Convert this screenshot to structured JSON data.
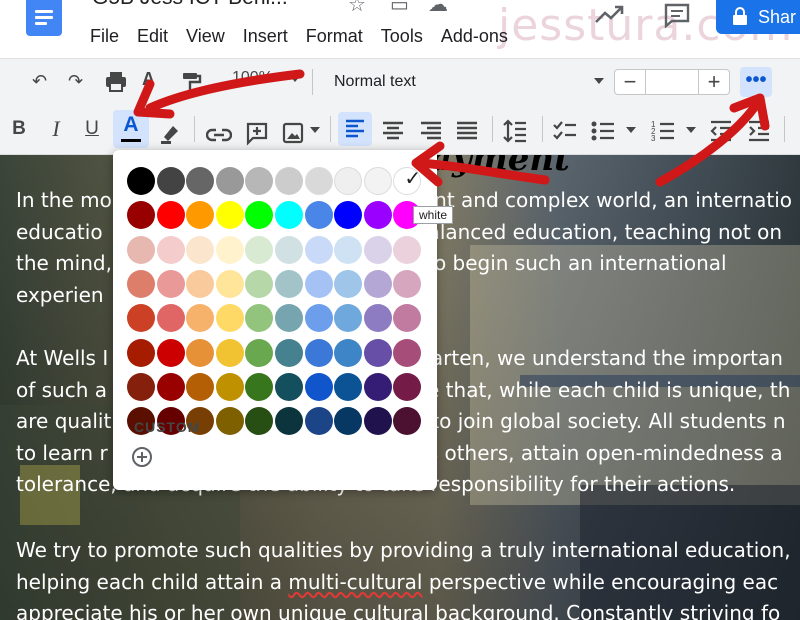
{
  "app": {
    "doc_title": "G5B Jess ICT Beni...",
    "watermark": "jesstura.com",
    "menu": [
      "File",
      "Edit",
      "View",
      "Insert",
      "Format",
      "Tools",
      "Add-ons"
    ],
    "share_label": "Shar"
  },
  "toolbar": {
    "zoom": "100%",
    "paragraph_style": "Normal text",
    "font_size_minus": "−",
    "font_size_plus": "+",
    "font_size_value": "",
    "more_label": "•••",
    "bold": "B",
    "italic": "I",
    "underline": "U",
    "text_color": "A"
  },
  "document": {
    "heading_fragment": "ayment",
    "paragraphs": [
      [
        "In the mo",
        "ent and complex world, an internatio",
        "educatio",
        "alanced education, teaching not on",
        "the mind,",
        "o begin such an international",
        "experien"
      ],
      []
    ],
    "p1": [
      {
        "a": "In the mo",
        "b": "ent and complex world, an internatio"
      },
      {
        "a": "educatio",
        "b": "alanced education, teaching not on"
      },
      {
        "a": "the mind,",
        "b": "o begin such an international"
      },
      {
        "a": "experien",
        "b": ""
      }
    ],
    "p2": [
      {
        "a": "At Wells I",
        "b": "garten, we understand the importan"
      },
      {
        "a": "of such a",
        "b": "e that, while each child is unique, th"
      },
      {
        "a": "are qualit",
        "b": "to join global society. All students n"
      },
      {
        "a": "to learn r",
        "b": "s others, attain open-mindedness a"
      },
      {
        "a": "tolerance, and acquire the ability to take responsibility for their actions.",
        "b": ""
      }
    ],
    "p3": [
      "We try to promote such qualities by providing a truly international education,",
      "helping each child attain a multi-cultural perspective while encouraging eac",
      "appreciate his or her own unique cultural background. Constantly striving fo"
    ],
    "p3_misspelled": "multi-cultural"
  },
  "palette": {
    "rows": [
      [
        "#000000",
        "#434343",
        "#666666",
        "#999999",
        "#b7b7b7",
        "#cccccc",
        "#d9d9d9",
        "#efefef",
        "#f3f3f3",
        "#ffffff"
      ],
      [
        "#980000",
        "#ff0000",
        "#ff9900",
        "#ffff00",
        "#00ff00",
        "#00ffff",
        "#4a86e8",
        "#0000ff",
        "#9900ff",
        "#ff00ff"
      ],
      [
        "#e6b8af",
        "#f4cccc",
        "#fce5cd",
        "#fff2cc",
        "#d9ead3",
        "#d0e0e3",
        "#c9daf8",
        "#cfe2f3",
        "#d9d2e9",
        "#ead1dc"
      ],
      [
        "#dd7e6b",
        "#ea9999",
        "#f9cb9c",
        "#ffe599",
        "#b6d7a8",
        "#a2c4c9",
        "#a4c2f4",
        "#9fc5e8",
        "#b4a7d6",
        "#d5a6bd"
      ],
      [
        "#cc4125",
        "#e06666",
        "#f6b26b",
        "#ffd966",
        "#93c47d",
        "#76a5af",
        "#6d9eeb",
        "#6fa8dc",
        "#8e7cc3",
        "#c27ba0"
      ],
      [
        "#a61c00",
        "#cc0000",
        "#e69138",
        "#f1c232",
        "#6aa84f",
        "#45818e",
        "#3c78d8",
        "#3d85c6",
        "#674ea7",
        "#a64d79"
      ],
      [
        "#85200c",
        "#990000",
        "#b45f06",
        "#bf9000",
        "#38761d",
        "#134f5c",
        "#1155cc",
        "#0b5394",
        "#351c75",
        "#741b47"
      ],
      [
        "#5b0f00",
        "#660000",
        "#783f04",
        "#7f6000",
        "#274e13",
        "#0c343d",
        "#1c4587",
        "#073763",
        "#20124d",
        "#4c1130"
      ]
    ],
    "selected": "#ffffff",
    "tooltip": "white",
    "custom_label": "CUSTOM",
    "check_mark": "✓"
  },
  "colors": {
    "accent": "#1a73e8",
    "toolbar_bg": "#f1f3f4",
    "active_bg": "#d3e3fd",
    "annotation_arrow": "#d01818"
  }
}
